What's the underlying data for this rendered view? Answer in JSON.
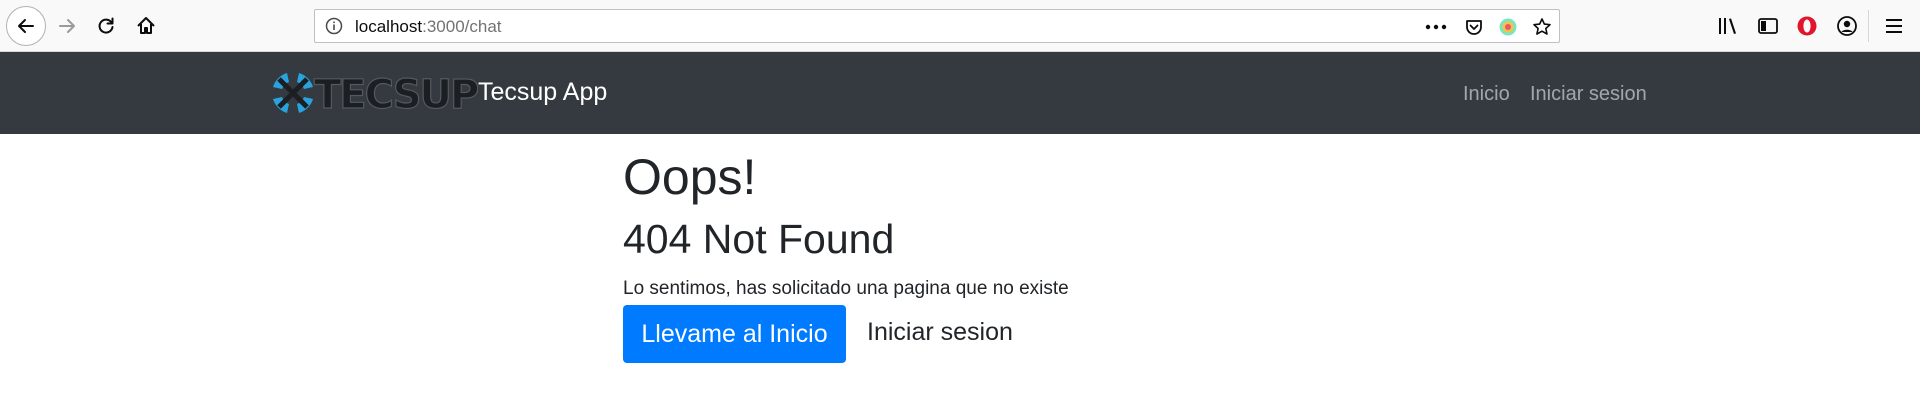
{
  "browser": {
    "url_host": "localhost",
    "url_path": ":3000/chat",
    "icons": [
      "back-arrow-icon",
      "forward-arrow-icon",
      "reload-icon",
      "home-icon",
      "info-icon",
      "more-icon",
      "pocket-icon",
      "extension-icon",
      "star-icon",
      "library-icon",
      "sidebar-icon",
      "opera-icon",
      "account-icon",
      "menu-icon"
    ]
  },
  "navbar": {
    "brand_text": "Tecsup App",
    "logo_text": "TECSUP",
    "links": [
      "Inicio",
      "Iniciar sesion"
    ],
    "colors": {
      "background": "#343a40"
    }
  },
  "main": {
    "title": "Oops!",
    "subtitle": "404 Not Found",
    "message": "Lo sentimos, has solicitado una pagina que no existe",
    "primary_button": "Llevame al Inicio",
    "secondary_link": "Iniciar sesion",
    "colors": {
      "primary": "#007bff"
    }
  }
}
